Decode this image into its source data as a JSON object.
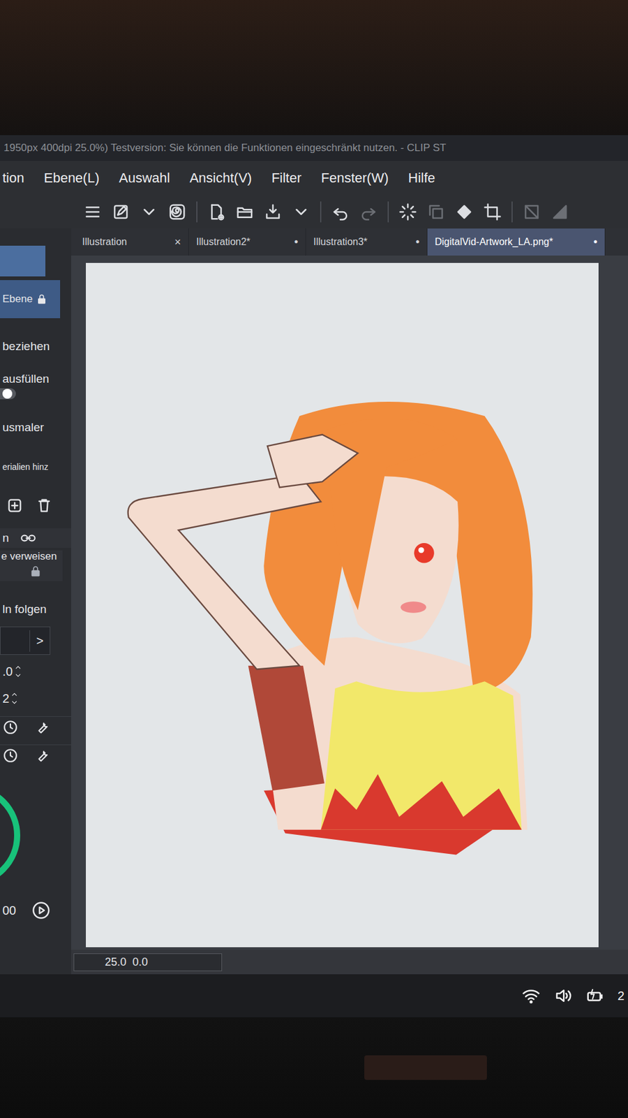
{
  "window": {
    "title": "1950px 400dpi 25.0%)  Testversion: Sie können die Funktionen eingeschränkt nutzen. - CLIP ST"
  },
  "menu": [
    "tion",
    "Ebene(L)",
    "Auswahl",
    "Ansicht(V)",
    "Filter",
    "Fenster(W)",
    "Hilfe"
  ],
  "tabs": [
    {
      "label": "Illustration",
      "mark": "×",
      "selected": false
    },
    {
      "label": "Illustration2*",
      "mark": "•",
      "selected": false
    },
    {
      "label": "Illustration3*",
      "mark": "•",
      "selected": false
    },
    {
      "label": "DigitalVid-Artwork_LA.png*",
      "mark": "•",
      "selected": true
    }
  ],
  "tool_property": [
    {
      "kind": "bar"
    },
    {
      "kind": "locked",
      "label": "Ebene",
      "selected": true
    },
    {
      "kind": "text",
      "label": "beziehen"
    },
    {
      "kind": "toggle",
      "label": "ausfüllen",
      "on": false
    },
    {
      "kind": "text",
      "label": "usmaler"
    },
    {
      "kind": "small",
      "label": "erialien hinz"
    },
    {
      "kind": "icons"
    },
    {
      "kind": "link",
      "label": "n"
    },
    {
      "kind": "locked-below",
      "label": "e verweisen"
    },
    {
      "kind": "text",
      "label": "ln folgen"
    },
    {
      "kind": "chevron",
      "label": ">"
    },
    {
      "kind": "spinner",
      "label": ".0"
    },
    {
      "kind": "spinner",
      "label": "2"
    },
    {
      "kind": "tools"
    },
    {
      "kind": "tools"
    },
    {
      "kind": "wheel"
    },
    {
      "kind": "play",
      "label": "00"
    }
  ],
  "status_bar": {
    "zoom": "25.0",
    "angle": "0.0"
  },
  "taskbar": {
    "clock": "2"
  }
}
